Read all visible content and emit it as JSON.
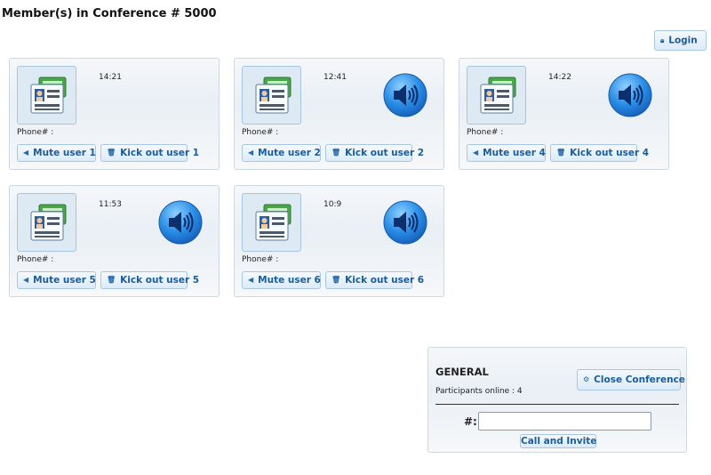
{
  "page": {
    "title": "Member(s) in Conference # 5000"
  },
  "header": {
    "login_label": "Login"
  },
  "members": [
    {
      "time": "14:21",
      "phone_label": "Phone# :",
      "mute_label": "Mute user 1",
      "kick_label": "Kick out user 1",
      "speaking": false
    },
    {
      "time": "12:41",
      "phone_label": "Phone# :",
      "mute_label": "Mute user 2",
      "kick_label": "Kick out user 2",
      "speaking": true
    },
    {
      "time": "14:22",
      "phone_label": "Phone# :",
      "mute_label": "Mute user 4",
      "kick_label": "Kick out user 4",
      "speaking": true
    },
    {
      "time": "11:53",
      "phone_label": "Phone# :",
      "mute_label": "Mute user 5",
      "kick_label": "Kick out user 5",
      "speaking": true
    },
    {
      "time": "10:9",
      "phone_label": "Phone# :",
      "mute_label": "Mute user 6",
      "kick_label": "Kick out user 6",
      "speaking": true
    }
  ],
  "general": {
    "title": "GENERAL",
    "participants_text": "Participants online : 4",
    "close_label": "Close Conference",
    "hash_label": "#:",
    "invite_value": "",
    "call_label": "Call and Invite"
  },
  "icons": {
    "login": "lock-icon",
    "mute": "left-triangle-icon",
    "kick": "trash-icon",
    "close": "gear-icon",
    "speaker": "speaker-icon",
    "avatar": "contact-card-icon"
  },
  "colors": {
    "accent": "#1b5c9b",
    "speaker_blue": "#1e7fd8"
  }
}
